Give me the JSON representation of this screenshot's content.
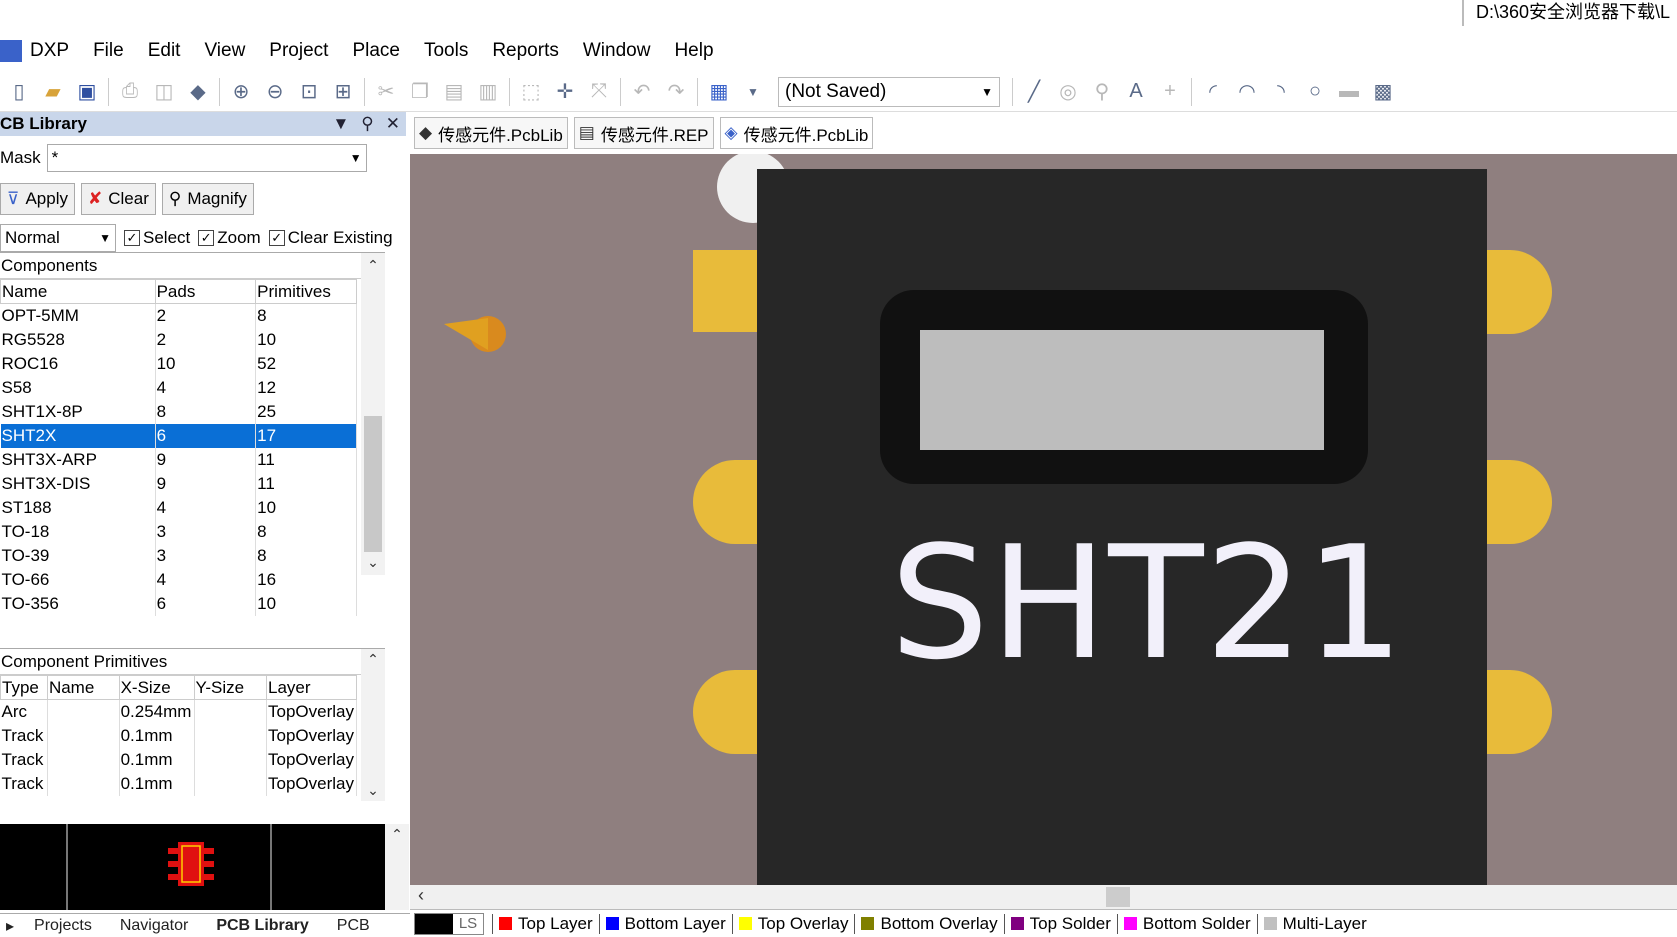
{
  "title_path": "D:\\360安全浏览器下载\\L",
  "menu": [
    "DXP",
    "File",
    "Edit",
    "View",
    "Project",
    "Place",
    "Tools",
    "Reports",
    "Window",
    "Help"
  ],
  "toolbar": {
    "save_state": "(Not Saved)"
  },
  "panel": {
    "title": "CB Library",
    "mask_label": "Mask",
    "mask_value": "*",
    "apply": "Apply",
    "clear": "Clear",
    "magnify": "Magnify",
    "mode": "Normal",
    "select": "Select",
    "zoom": "Zoom",
    "clear_existing": "Clear Existing"
  },
  "components": {
    "title": "Components",
    "headers": [
      "Name",
      "Pads",
      "Primitives"
    ],
    "rows": [
      [
        "OPT-5MM",
        "2",
        "8"
      ],
      [
        "RG5528",
        "2",
        "10"
      ],
      [
        "ROC16",
        "10",
        "52"
      ],
      [
        "S58",
        "4",
        "12"
      ],
      [
        "SHT1X-8P",
        "8",
        "25"
      ],
      [
        "SHT2X",
        "6",
        "17"
      ],
      [
        "SHT3X-ARP",
        "9",
        "11"
      ],
      [
        "SHT3X-DIS",
        "9",
        "11"
      ],
      [
        "ST188",
        "4",
        "10"
      ],
      [
        "TO-18",
        "3",
        "8"
      ],
      [
        "TO-39",
        "3",
        "8"
      ],
      [
        "TO-66",
        "4",
        "16"
      ],
      [
        "TO-356",
        "6",
        "10"
      ]
    ],
    "selected_index": 5
  },
  "primitives": {
    "title": "Component Primitives",
    "headers": [
      "Type",
      "Name",
      "X-Size",
      "Y-Size",
      "Layer"
    ],
    "rows": [
      [
        "Arc",
        "",
        "0.254mm",
        "",
        "TopOverlay"
      ],
      [
        "Track",
        "",
        "0.1mm",
        "",
        "TopOverlay"
      ],
      [
        "Track",
        "",
        "0.1mm",
        "",
        "TopOverlay"
      ],
      [
        "Track",
        "",
        "0.1mm",
        "",
        "TopOverlay"
      ]
    ]
  },
  "bottom_tabs": [
    "Projects",
    "Navigator",
    "PCB Library",
    "PCB"
  ],
  "doc_tabs": [
    "传感元件.PcbLib",
    "传感元件.REP",
    "传感元件.PcbLib"
  ],
  "chip_label": "SHT21",
  "layers": {
    "ls": "LS",
    "items": [
      {
        "name": "Top Layer",
        "color": "#ff0000"
      },
      {
        "name": "Bottom Layer",
        "color": "#0000ff"
      },
      {
        "name": "Top Overlay",
        "color": "#ffff00"
      },
      {
        "name": "Bottom Overlay",
        "color": "#808000"
      },
      {
        "name": "Top Solder",
        "color": "#800080"
      },
      {
        "name": "Bottom Solder",
        "color": "#ff00ff"
      },
      {
        "name": "Multi-Layer",
        "color": "#c0c0c0"
      }
    ]
  }
}
